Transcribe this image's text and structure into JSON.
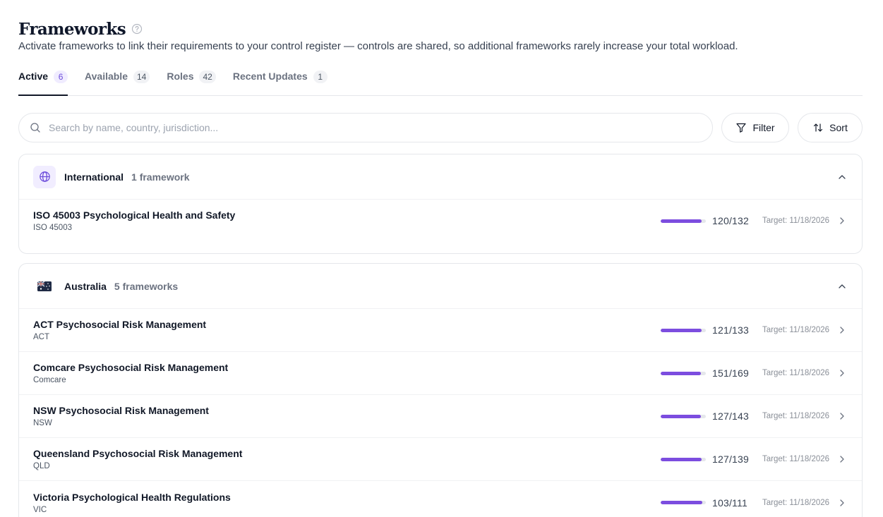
{
  "header": {
    "title": "Frameworks",
    "subtitle": "Activate frameworks to link their requirements to your control register — controls are shared, so additional frameworks rarely increase your total workload."
  },
  "tabs": [
    {
      "label": "Active",
      "count": "6",
      "active": true
    },
    {
      "label": "Available",
      "count": "14",
      "active": false
    },
    {
      "label": "Roles",
      "count": "42",
      "active": false
    },
    {
      "label": "Recent Updates",
      "count": "1",
      "active": false
    }
  ],
  "toolbar": {
    "search_placeholder": "Search by name, country, jurisdiction...",
    "filter_label": "Filter",
    "sort_label": "Sort"
  },
  "groups": [
    {
      "name": "International",
      "count_label": "1 framework",
      "icon": "globe-icon",
      "frameworks": [
        {
          "name": "ISO 45003 Psychological Health and Safety",
          "code": "ISO 45003",
          "done": 120,
          "total": 132,
          "ratio": "120/132",
          "target": "Target: 11/18/2026"
        }
      ]
    },
    {
      "name": "Australia",
      "count_label": "5 frameworks",
      "icon": "australia-flag-icon",
      "frameworks": [
        {
          "name": "ACT Psychosocial Risk Management",
          "code": "ACT",
          "done": 121,
          "total": 133,
          "ratio": "121/133",
          "target": "Target: 11/18/2026"
        },
        {
          "name": "Comcare Psychosocial Risk Management",
          "code": "Comcare",
          "done": 151,
          "total": 169,
          "ratio": "151/169",
          "target": "Target: 11/18/2026"
        },
        {
          "name": "NSW Psychosocial Risk Management",
          "code": "NSW",
          "done": 127,
          "total": 143,
          "ratio": "127/143",
          "target": "Target: 11/18/2026"
        },
        {
          "name": "Queensland Psychosocial Risk Management",
          "code": "QLD",
          "done": 127,
          "total": 139,
          "ratio": "127/139",
          "target": "Target: 11/18/2026"
        },
        {
          "name": "Victoria Psychological Health Regulations",
          "code": "VIC",
          "done": 103,
          "total": 111,
          "ratio": "103/111",
          "target": "Target: 11/18/2026"
        }
      ]
    }
  ],
  "colors": {
    "accent": "#7c4ddf",
    "track": "#e5e7eb"
  }
}
